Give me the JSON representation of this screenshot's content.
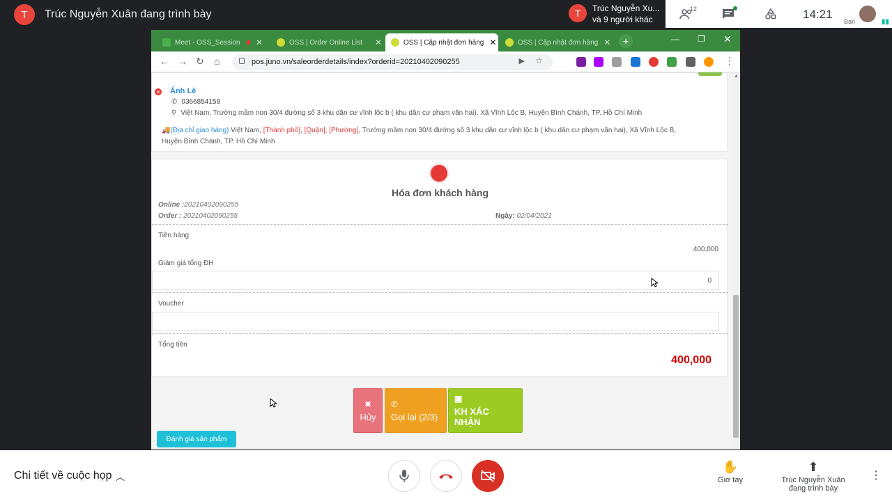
{
  "meet": {
    "presenter_initial": "T",
    "presenter_title": "Trúc Nguyễn Xuân đang trình bày",
    "participant_initial": "T",
    "participant_line1": "Trúc Nguyễn Xu...",
    "participant_line2": "và 9 người khác",
    "people_count": "12",
    "time": "14:21",
    "self_label": "Bạn",
    "details_label": "Chi tiết về cuộc họp",
    "raise_hand_label": "Giơ tay",
    "present_label": "Trúc Nguyễn Xuân đang trình bày"
  },
  "browser": {
    "tabs": [
      {
        "label": "Meet - OSS_Session"
      },
      {
        "label": "OSS | Order Online List"
      },
      {
        "label": "OSS | Cập nhật đơn hàng"
      },
      {
        "label": "OSS | Cập nhật đơn hàng"
      }
    ],
    "url": "pos.juno.vn/saleorderdetails/index?orderid=20210402090255"
  },
  "customer": {
    "name": "Ánh Lê",
    "phone": "0366854158",
    "address": "Việt Nam, Trường mầm non 30/4 đường số 3 khu dân cư vĩnh lộc b ( khu dân cư phạm văn hai), Xã Vĩnh Lộc B, Huyện Bình Chánh, TP. Hồ Chí Minh",
    "ship_label": "(Địa chỉ giao hàng)",
    "ship_country": "Việt Nam,",
    "ship_city": "[Thành phố]",
    "ship_district": "[Quận]",
    "ship_ward": "[Phường]",
    "ship_rest_1": "Trường mầm non 30/4 đường số 3 khu dân cư vĩnh lộc b ( khu dân cư phạm văn hai), Xã Vĩnh Lộc B,",
    "ship_rest_2": "Huyện Bình Chánh, TP. Hồ Chí Minh"
  },
  "invoice": {
    "title": "Hóa đơn khách hàng",
    "online_label": "Online :",
    "online_value": "20210402090255",
    "order_label": "Order : ",
    "order_value": "20210402090255",
    "date_label": "Ngày:",
    "date_value": "02/04/2021",
    "subtotal_label": "Tiền hàng",
    "subtotal_value": "400,000",
    "discount_label": "Giảm giá tổng ĐH",
    "discount_value": "0",
    "voucher_label": "Voucher",
    "voucher_value": "",
    "total_label": "Tổng tiền",
    "total_value": "400,000"
  },
  "actions": {
    "cancel": "Hủy",
    "call": "Gọi lại (2/3)",
    "confirm": "KH XÁC NHẬN",
    "review": "Đánh giá sản phẩm"
  },
  "colors": {
    "accent_blue": "#2a8bd6",
    "total_red": "#d50000",
    "meet_red": "#d93025"
  }
}
